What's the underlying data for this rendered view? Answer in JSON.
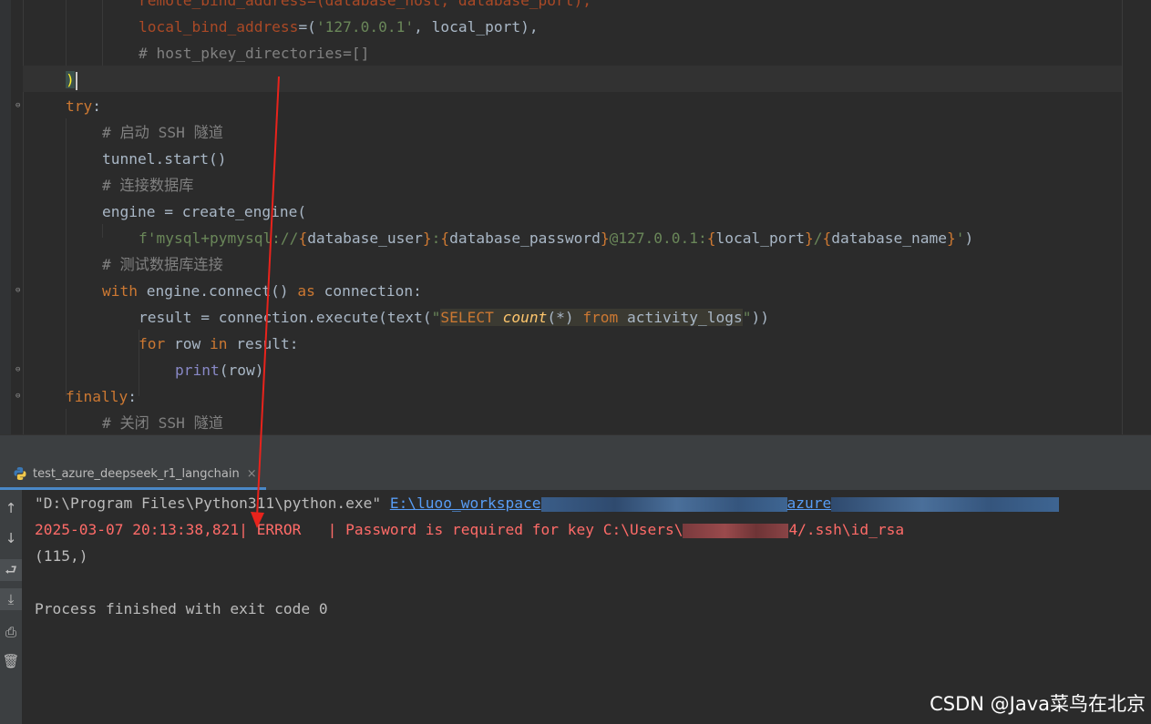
{
  "editor": {
    "lines": {
      "l0": "remote_bind_address=(database_host, database_port),",
      "l1_a": "local_bind_address",
      "l1_b": "=(",
      "l1_c": "'127.0.0.1'",
      "l1_d": ", local_port),",
      "l2": "# host_pkey_directories=[]",
      "l3": ")",
      "l4_a": "try",
      "l4_b": ":",
      "l5": "# 启动 SSH 隧道",
      "l6": "tunnel.start()",
      "l7": "# 连接数据库",
      "l8": "engine = create_engine(",
      "l9_a": "f'mysql+pymysql://",
      "l9_b": "{",
      "l9_c": "database_user",
      "l9_d": "}",
      "l9_e": ":",
      "l9_f": "{",
      "l9_g": "database_password",
      "l9_h": "}",
      "l9_i": "@127.0.0.1:",
      "l9_j": "{",
      "l9_k": "local_port",
      "l9_l": "}",
      "l9_m": "/",
      "l9_n": "{",
      "l9_o": "database_name",
      "l9_p": "}",
      "l9_q": "'",
      "l9_r": ")",
      "l10": "# 测试数据库连接",
      "l11_a": "with",
      "l11_b": " engine.connect() ",
      "l11_c": "as",
      "l11_d": " connection:",
      "l12_a": "result = connection.execute(text(",
      "l12_b": "\"",
      "l12_c": "SELECT ",
      "l12_d": "count",
      "l12_e": "(*) ",
      "l12_f": "from",
      "l12_g": " activity_logs",
      "l12_h": "\"",
      "l12_i": "))",
      "l13_a": "for",
      "l13_b": " row ",
      "l13_c": "in",
      "l13_d": " result:",
      "l14_a": "print",
      "l14_b": "(row)",
      "l15_a": "finally",
      "l15_b": ":",
      "l16": "# 关闭 SSH 隧道"
    }
  },
  "run_tab": {
    "label": "test_azure_deepseek_r1_langchain",
    "close": "×"
  },
  "console": {
    "cmd_prefix": "\"D:\\Program Files\\Python311\\python.exe\" ",
    "cmd_link": "E:\\luoo_workspace",
    "cmd_link_tail": "azure",
    "error_a": "2025-03-07 20:13:38,821| ERROR   | Password is required for key C:\\Users\\",
    "error_b": "4/.ssh\\id_rsa",
    "result": "(115,)",
    "finished": "Process finished with exit code 0"
  },
  "tools": [
    "up-arrow-icon",
    "down-arrow-icon",
    "soft-wrap-icon",
    "scroll-to-end-icon",
    "print-icon",
    "trash-icon"
  ],
  "watermark": "CSDN @Java菜鸟在北京"
}
